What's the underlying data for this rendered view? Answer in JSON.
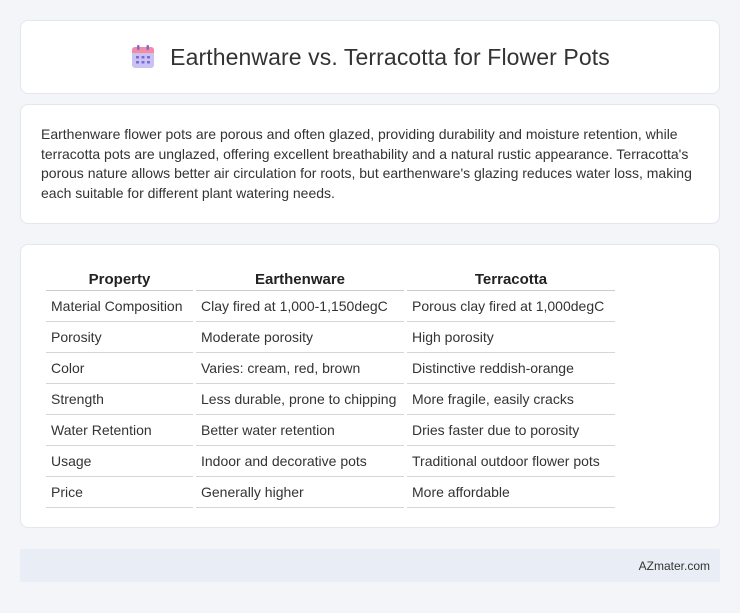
{
  "header": {
    "title": "Earthenware vs. Terracotta for Flower Pots",
    "icon": "calendar-icon"
  },
  "summary": {
    "text": "Earthenware flower pots are porous and often glazed, providing durability and moisture retention, while terracotta pots are unglazed, offering excellent breathability and a natural rustic appearance. Terracotta's porous nature allows better air circulation for roots, but earthenware's glazing reduces water loss, making each suitable for different plant watering needs."
  },
  "table": {
    "headers": [
      "Property",
      "Earthenware",
      "Terracotta"
    ],
    "rows": [
      [
        "Material Composition",
        "Clay fired at 1,000-1,150degC",
        "Porous clay fired at 1,000degC"
      ],
      [
        "Porosity",
        "Moderate porosity",
        "High porosity"
      ],
      [
        "Color",
        "Varies: cream, red, brown",
        "Distinctive reddish-orange"
      ],
      [
        "Strength",
        "Less durable, prone to chipping",
        "More fragile, easily cracks"
      ],
      [
        "Water Retention",
        "Better water retention",
        "Dries faster due to porosity"
      ],
      [
        "Usage",
        "Indoor and decorative pots",
        "Traditional outdoor flower pots"
      ],
      [
        "Price",
        "Generally higher",
        "More affordable"
      ]
    ]
  },
  "footer": {
    "text": "AZmater.com"
  },
  "colors": {
    "background": "#f3f5f9",
    "card": "#ffffff",
    "footer": "#e9eef6",
    "icon_purple": "#8f7de6",
    "icon_top": "#f26b8a"
  }
}
